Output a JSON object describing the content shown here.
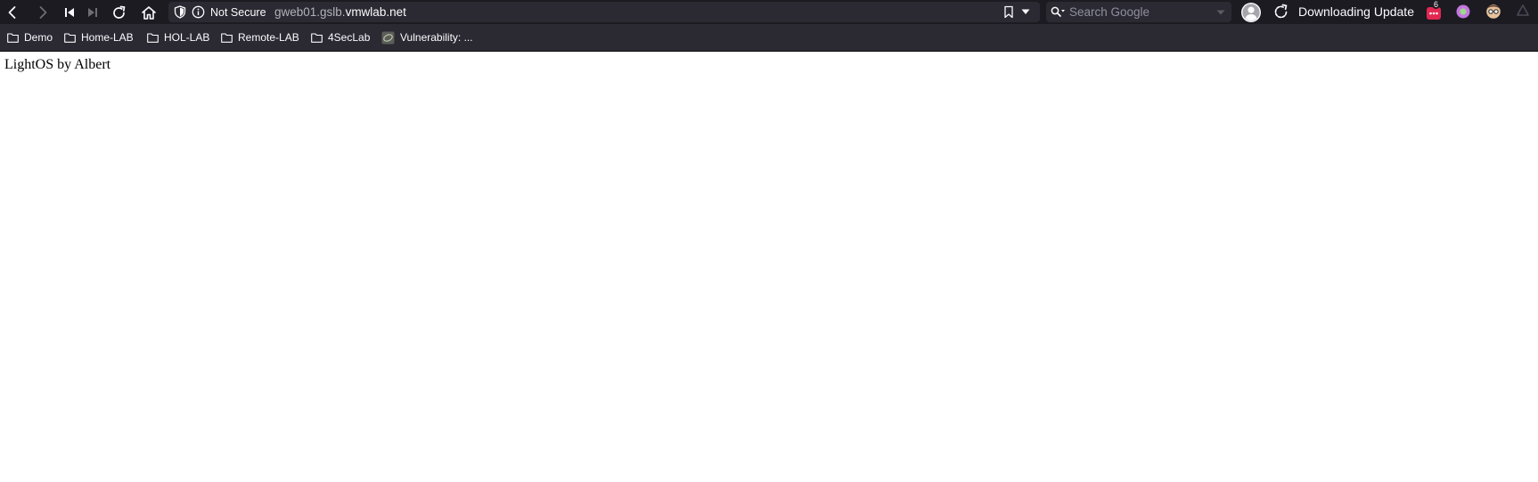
{
  "toolbar": {
    "security_label": "Not Secure",
    "url_subdomain": "gweb01.gslb.",
    "url_domain": "vmwlab.net",
    "search_placeholder": "Search Google",
    "update_status": "Downloading Update",
    "extension_badge_count": "6",
    "icons": {
      "back": "chevron-left-icon",
      "forward": "chevron-right-icon",
      "first": "skip-back-icon",
      "last": "skip-forward-icon",
      "reload": "reload-icon",
      "home": "home-icon",
      "shield": "shield-icon",
      "info": "info-icon",
      "bookmark": "bookmark-icon",
      "search": "search-icon",
      "account": "account-icon",
      "update": "update-icon"
    }
  },
  "bookmarks": {
    "items": [
      {
        "label": "Demo",
        "icon": "folder-icon"
      },
      {
        "label": "Home-LAB",
        "icon": "folder-icon"
      },
      {
        "label": "HOL-LAB",
        "icon": "folder-icon"
      },
      {
        "label": "Remote-LAB",
        "icon": "folder-icon"
      },
      {
        "label": "4SecLab",
        "icon": "folder-icon"
      },
      {
        "label": "Vulnerability: ...",
        "icon": "site-favicon"
      }
    ]
  },
  "page": {
    "body_text": "LightOS by Albert"
  },
  "colors": {
    "toolbar_bg": "#1c1b22",
    "field_bg": "#2b2a33",
    "text_primary": "#fbfbfe",
    "text_muted": "#8f8f9d",
    "page_bg": "#ffffff"
  }
}
